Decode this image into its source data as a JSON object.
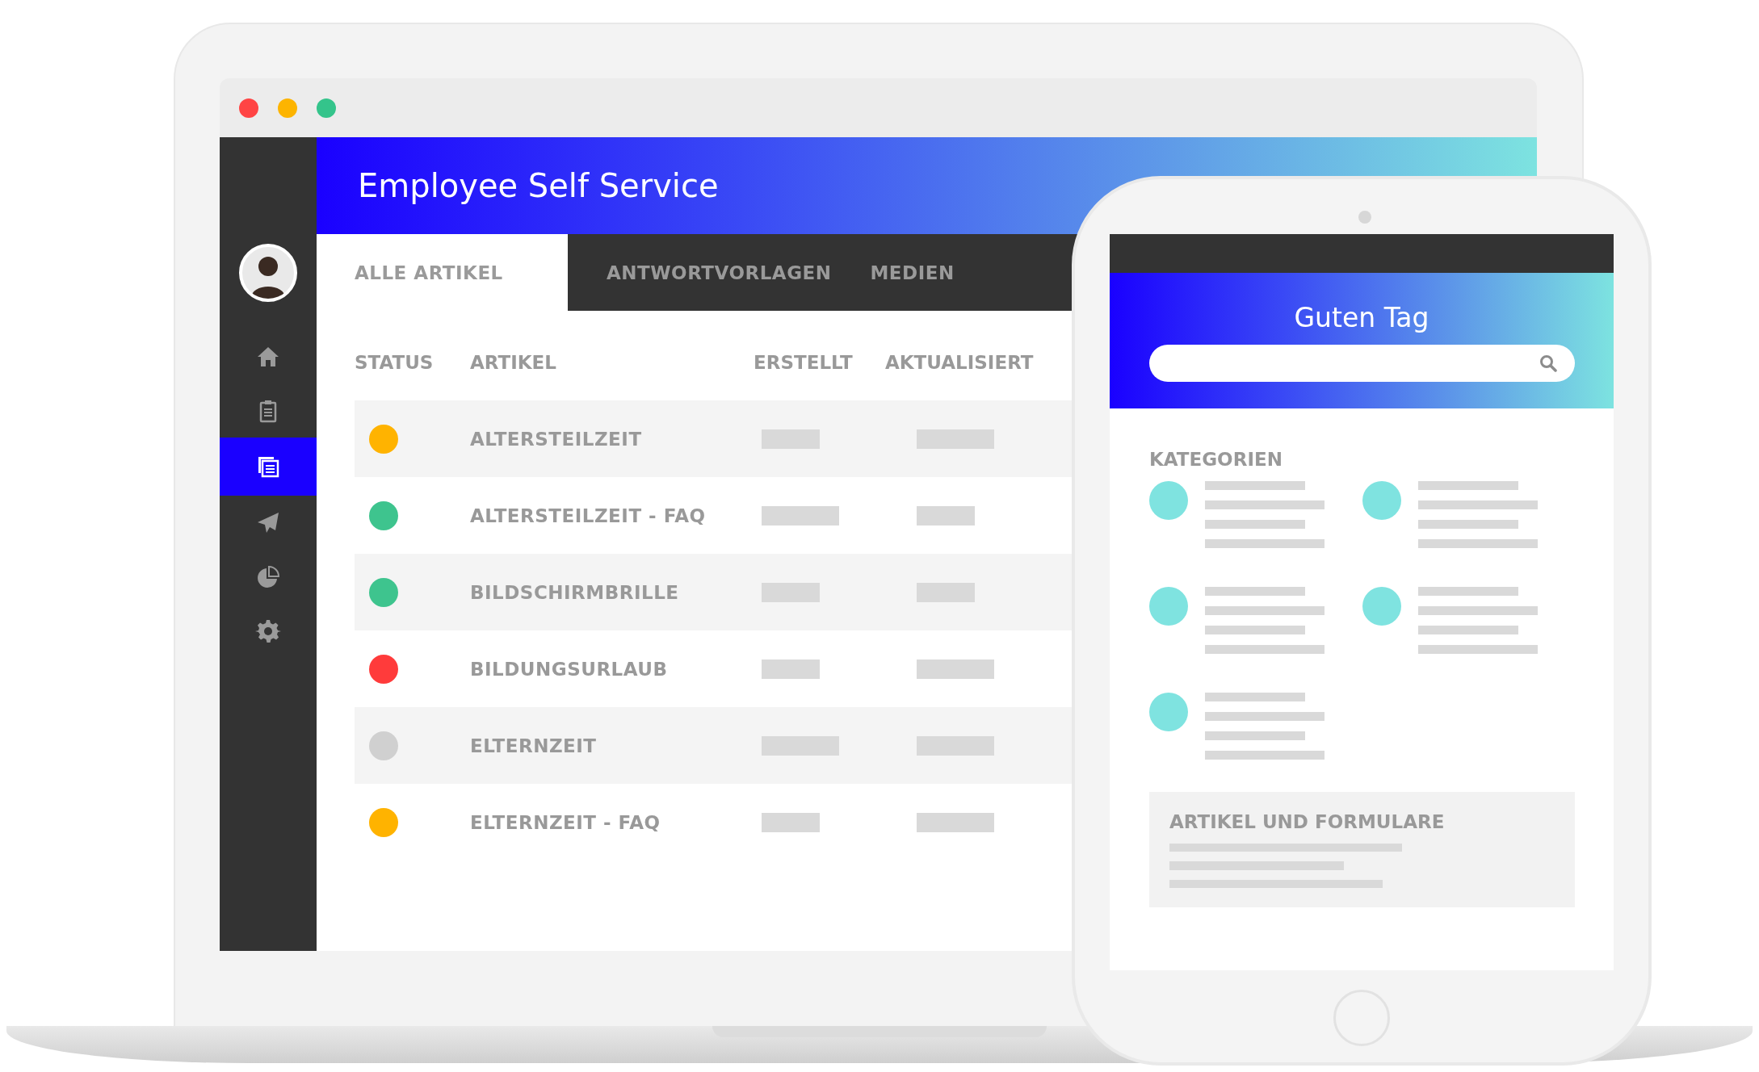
{
  "laptop": {
    "app_title": "Employee Self Service",
    "sidebar": {
      "items": [
        {
          "kind": "home",
          "selected": false
        },
        {
          "kind": "clipboard",
          "selected": false
        },
        {
          "kind": "documents",
          "selected": true
        },
        {
          "kind": "send",
          "selected": false
        },
        {
          "kind": "chart",
          "selected": false
        },
        {
          "kind": "settings",
          "selected": false
        }
      ]
    },
    "tabs": [
      {
        "label": "ALLE ARTIKEL",
        "selected": true
      },
      {
        "label": "ANTWORTVORLAGEN",
        "selected": false
      },
      {
        "label": "MEDIEN",
        "selected": false
      }
    ],
    "table": {
      "columns": [
        "STATUS",
        "ARTIKEL",
        "ERSTELLT",
        "AKTUALISIERT"
      ],
      "rows": [
        {
          "color": "#ffb300",
          "artikel": "ALTERSTEILZEIT"
        },
        {
          "color": "#3ec48e",
          "artikel": "ALTERSTEILZEIT - FAQ"
        },
        {
          "color": "#3ec48e",
          "artikel": "BILDSCHIRMBRILLE"
        },
        {
          "color": "#ff3b3b",
          "artikel": "BILDUNGSURLAUB"
        },
        {
          "color": "#d0d0d0",
          "artikel": "ELTERNZEIT"
        },
        {
          "color": "#ffb300",
          "artikel": "ELTERNZEIT - FAQ"
        }
      ]
    }
  },
  "tablet": {
    "greeting": "Guten Tag",
    "categories_title": "KATEGORIEN",
    "categories": [
      {
        "kind": "category"
      },
      {
        "kind": "category"
      },
      {
        "kind": "category"
      },
      {
        "kind": "category"
      },
      {
        "kind": "category"
      }
    ],
    "card_title": "ARTIKEL UND FORMULARE"
  }
}
